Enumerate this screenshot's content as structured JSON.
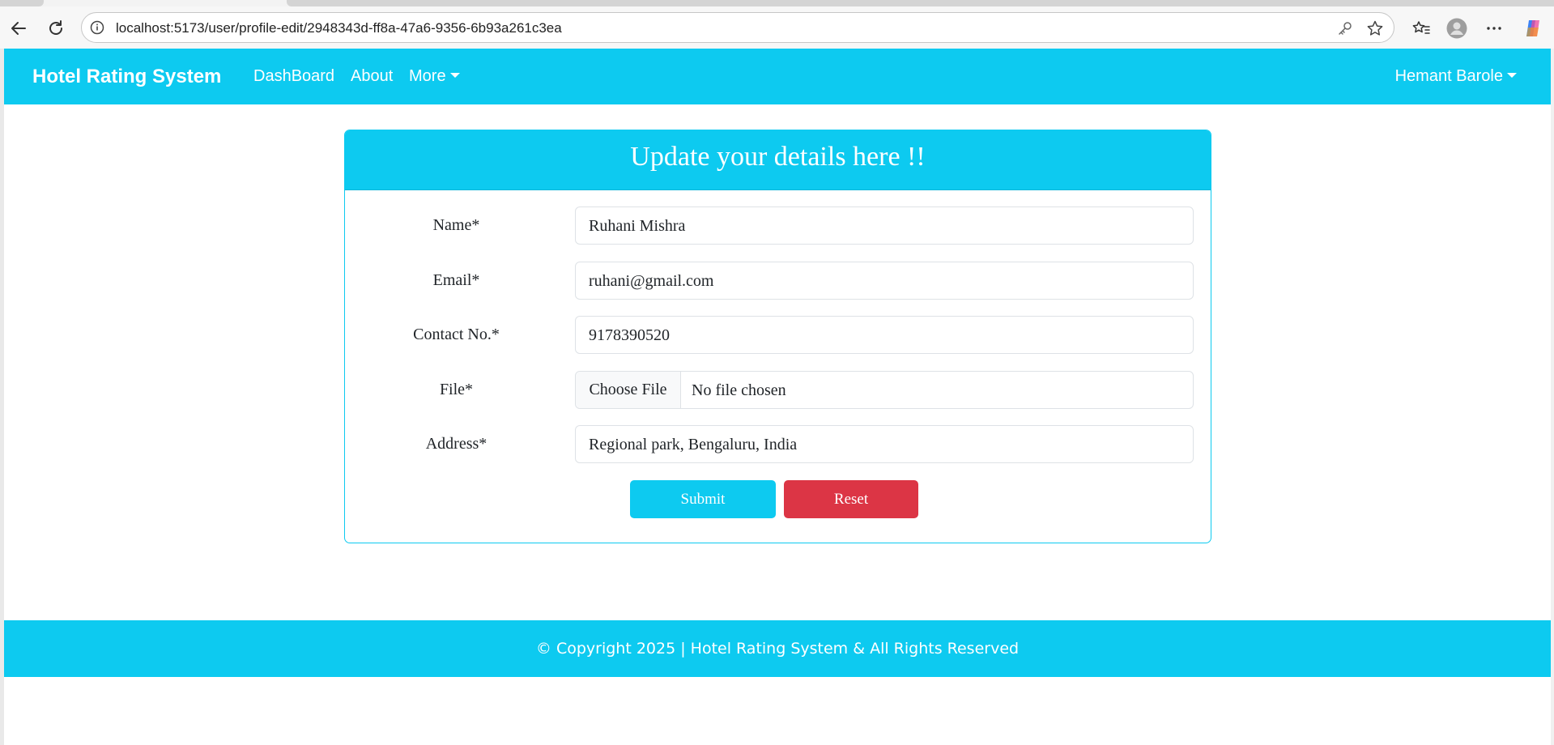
{
  "browser": {
    "url": "localhost:5173/user/profile-edit/2948343d-ff8a-47a6-9356-6b93a261c3ea"
  },
  "navbar": {
    "brand": "Hotel Rating System",
    "links": [
      "DashBoard",
      "About",
      "More"
    ],
    "user": "Hemant Barole"
  },
  "form": {
    "title": "Update your details here !!",
    "fields": [
      {
        "label": "Name*",
        "value": "Ruhani Mishra"
      },
      {
        "label": "Email*",
        "value": "ruhani@gmail.com"
      },
      {
        "label": "Contact No.*",
        "value": "9178390520"
      },
      {
        "label": "File*",
        "button": "Choose File",
        "value": "No file chosen"
      },
      {
        "label": "Address*",
        "value": "Regional park, Bengaluru, India"
      }
    ],
    "submit_label": "Submit",
    "reset_label": "Reset"
  },
  "footer": {
    "text": "© Copyright 2025 | Hotel Rating System & All Rights Reserved"
  },
  "colors": {
    "primary": "#0dcaf0",
    "danger": "#dc3545"
  }
}
